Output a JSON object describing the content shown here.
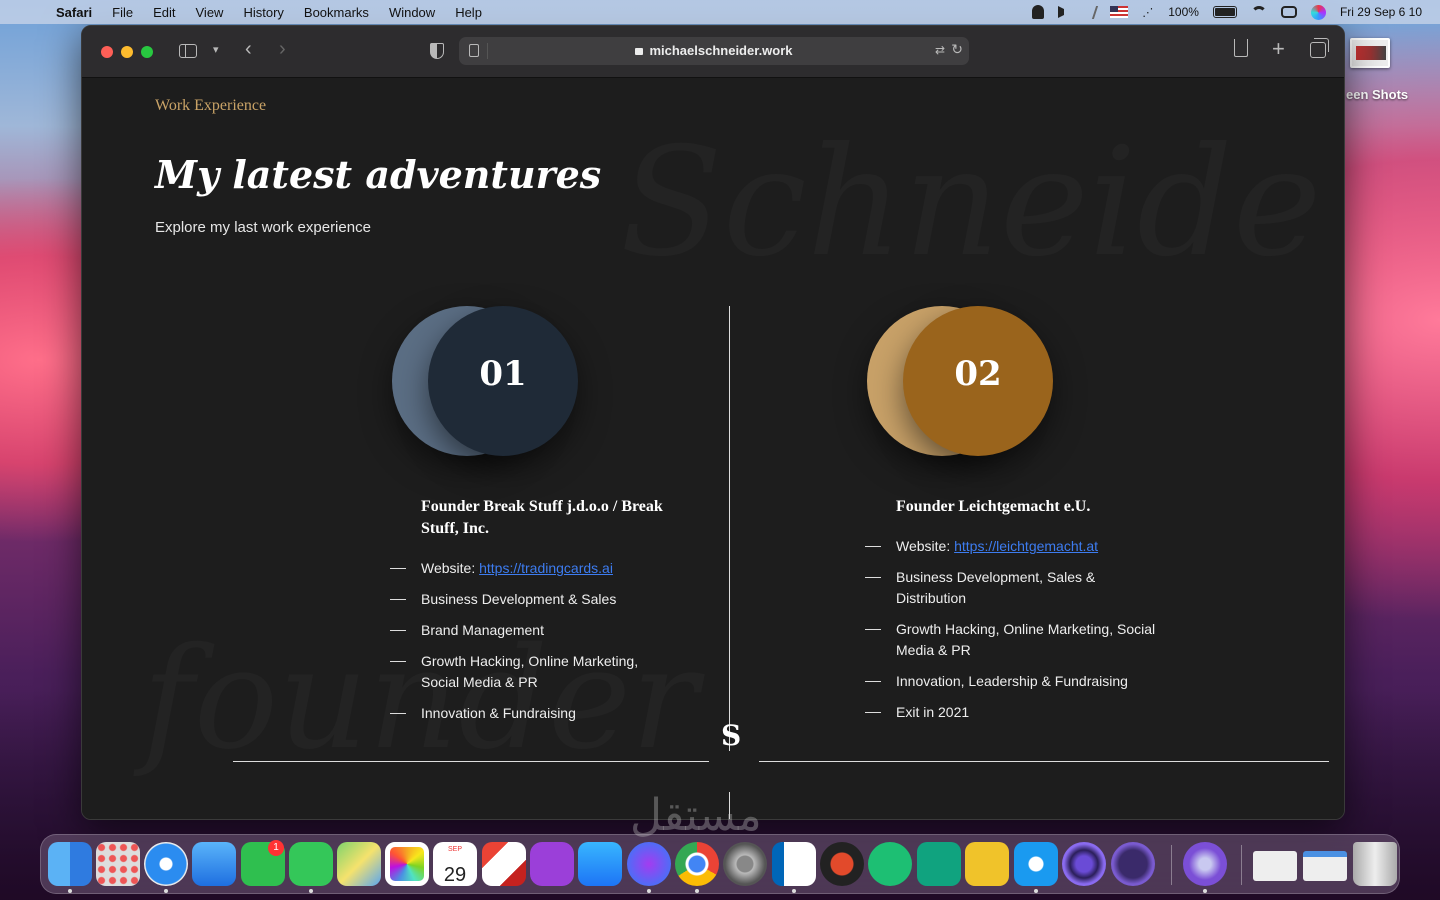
{
  "menubar": {
    "app": "Safari",
    "items": [
      "File",
      "Edit",
      "View",
      "History",
      "Bookmarks",
      "Window",
      "Help"
    ],
    "battery": "100%",
    "datetime": "Fri 29 Sep  6 10"
  },
  "desktop": {
    "screenshots_label": "een Shots"
  },
  "browser": {
    "url": "michaelschneider.work"
  },
  "page": {
    "eyebrow": "Work Experience",
    "title": "My latest adventures",
    "subtitle": "Explore my last work experience",
    "bg_word_top": "Schneide",
    "bg_word_bottom": "founder",
    "logo_letter": "S",
    "jobs": [
      {
        "number": "01",
        "title": "Founder Break Stuff j.d.o.o / Break Stuff, Inc.",
        "website_label": "Website: ",
        "website_url": "https://tradingcards.ai",
        "items": [
          "Business Development & Sales",
          "Brand Management",
          "Growth Hacking, Online Marketing, Social Media & PR",
          "Innovation & Fundraising"
        ]
      },
      {
        "number": "02",
        "title": "Founder Leichtgemacht e.U.",
        "website_label": "Website: ",
        "website_url": "https://leichtgemacht.at",
        "items": [
          "Business Development, Sales & Distribution",
          "Growth Hacking, Online Marketing, Social Media & PR",
          "Innovation, Leadership & Fundraising",
          "Exit in 2021"
        ]
      }
    ]
  },
  "dock": {
    "calendar_month": "SEP",
    "calendar_day": "29",
    "facetime_badge": "1",
    "apps": [
      "finder",
      "launchpad",
      "safari",
      "mail",
      "facetime",
      "messages",
      "maps",
      "photos",
      "calendar",
      "gmail",
      "podcasts",
      "app-store",
      "messenger",
      "chrome",
      "system-preferences",
      "vscode",
      "screen-recorder",
      "fiverr",
      "chatgpt",
      "app-5",
      "screen-capture",
      "proxyman",
      "pockity",
      "disk-utility",
      "preview-window",
      "screenshot-window",
      "trash"
    ]
  },
  "watermark": "مستقل",
  "colors": {
    "accent": "#c9a367",
    "link": "#3d7cf0",
    "circle1_back": "#5b6e84",
    "circle1_front": "#1f2a37",
    "circle2_back": "#c8a168",
    "circle2_front": "#9a641c"
  }
}
